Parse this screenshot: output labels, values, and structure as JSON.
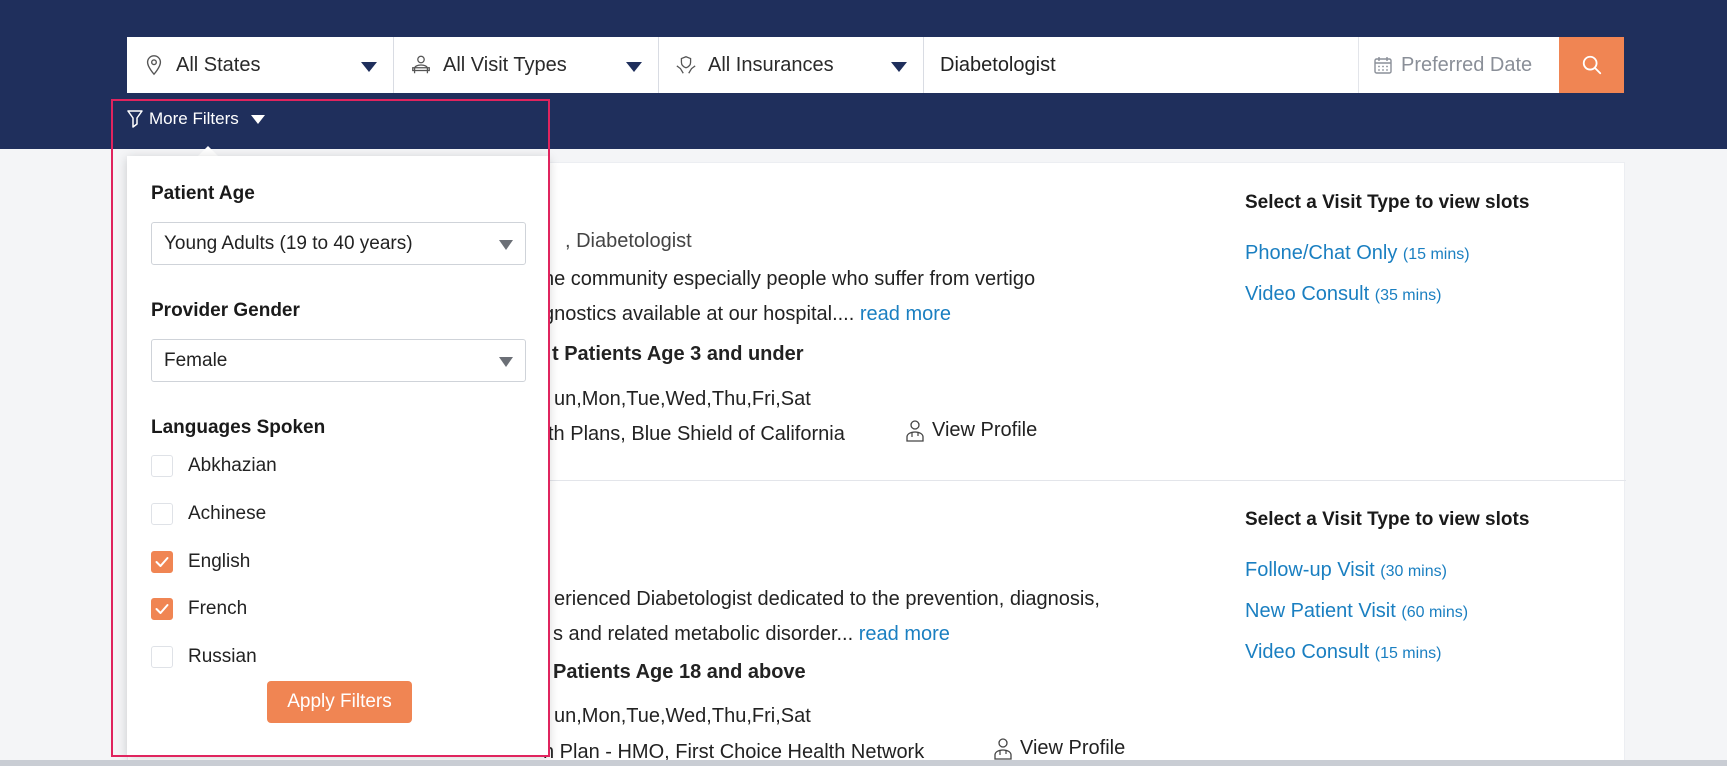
{
  "search": {
    "state": "All States",
    "visit_type": "All Visit Types",
    "insurance": "All Insurances",
    "specialty": "Diabetologist",
    "date_placeholder": "Preferred Date"
  },
  "more_filters": {
    "label": "More Filters"
  },
  "filters": {
    "age_label": "Patient Age",
    "age_value": "Young Adults (19 to 40 years)",
    "gender_label": "Provider Gender",
    "gender_value": "Female",
    "languages_label": "Languages Spoken",
    "languages": [
      {
        "name": "Abkhazian",
        "checked": false
      },
      {
        "name": "Achinese",
        "checked": false
      },
      {
        "name": "English",
        "checked": true
      },
      {
        "name": "French",
        "checked": true
      },
      {
        "name": "Russian",
        "checked": false
      }
    ],
    "apply_label": "Apply Filters"
  },
  "results": [
    {
      "specialty_frag": ", Diabetologist",
      "desc_line1": "he community especially people who suffer from vertigo",
      "desc_line2": "gnostics available at our hospital....",
      "read_more": "read more",
      "age_frag": "t Patients Age 3 and under",
      "days_frag": "un,Mon,Tue,Wed,Thu,Fri,Sat",
      "plans_frag": "th Plans, Blue Shield of California",
      "view_profile": "View Profile",
      "slots_title": "Select a Visit Type to view slots",
      "slots": [
        {
          "name": "Phone/Chat Only",
          "duration": "(15 mins)"
        },
        {
          "name": "Video Consult",
          "duration": "(35 mins)"
        }
      ]
    },
    {
      "desc_line1": "erienced Diabetologist dedicated to the prevention, diagnosis,",
      "desc_line2": "s and related metabolic disorder...",
      "read_more": "read more",
      "age_frag": "Patients Age 18 and above",
      "days_frag": "un,Mon,Tue,Wed,Thu,Fri,Sat",
      "plans_frag": "h Plan - HMO, First Choice Health Network",
      "view_profile": "View Profile",
      "slots_title": "Select a Visit Type to view slots",
      "slots": [
        {
          "name": "Follow-up Visit",
          "duration": "(30 mins)"
        },
        {
          "name": "New Patient Visit",
          "duration": "(60 mins)"
        },
        {
          "name": "Video Consult",
          "duration": "(15 mins)"
        }
      ]
    }
  ],
  "colors": {
    "navy": "#1f2f5c",
    "accent": "#f08553",
    "link": "#1a7fc1",
    "highlight": "#e0245e"
  }
}
